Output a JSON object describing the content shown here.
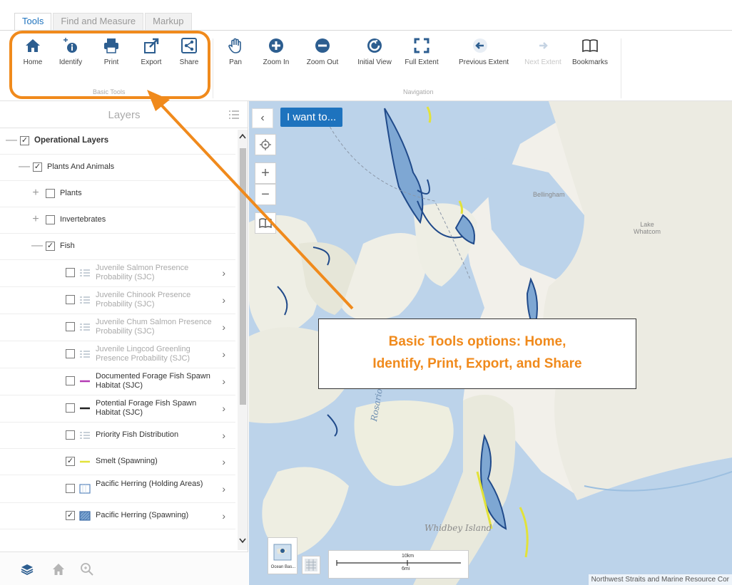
{
  "ribbon": {
    "tabs": [
      "Tools",
      "Find and Measure",
      "Markup"
    ],
    "basic_tools": {
      "group_label": "Basic Tools",
      "items": [
        {
          "label": "Home",
          "icon": "home-icon"
        },
        {
          "label": "Identify",
          "icon": "identify-icon"
        },
        {
          "label": "Print",
          "icon": "print-icon"
        },
        {
          "label": "Export",
          "icon": "export-icon"
        },
        {
          "label": "Share",
          "icon": "share-icon"
        }
      ]
    },
    "navigation": {
      "group_label": "Navigation",
      "items": [
        {
          "label": "Pan",
          "icon": "pan-hand-icon"
        },
        {
          "label": "Zoom In",
          "icon": "zoom-in-icon"
        },
        {
          "label": "Zoom Out",
          "icon": "zoom-out-icon"
        },
        {
          "label": "Initial View",
          "icon": "initial-view-icon"
        },
        {
          "label": "Full Extent",
          "icon": "full-extent-icon"
        },
        {
          "label": "Previous Extent",
          "icon": "previous-extent-icon"
        },
        {
          "label": "Next Extent",
          "icon": "next-extent-icon"
        },
        {
          "label": "Bookmarks",
          "icon": "bookmarks-icon"
        }
      ]
    }
  },
  "layers_panel": {
    "title": "Layers",
    "rows": [
      {
        "label": "Operational Layers",
        "checked": true,
        "expander": "—"
      },
      {
        "label": "Plants And Animals",
        "checked": true,
        "expander": "—"
      },
      {
        "label": "Plants",
        "checked": false,
        "expander": "+"
      },
      {
        "label": "Invertebrates",
        "checked": false,
        "expander": "+"
      },
      {
        "label": "Fish",
        "checked": true,
        "expander": "—"
      },
      {
        "label": "Juvenile Salmon Presence Probability (SJC)",
        "checked": false
      },
      {
        "label": "Juvenile Chinook Presence Probability (SJC)",
        "checked": false
      },
      {
        "label": "Juvenile Chum Salmon Presence Probability (SJC)",
        "checked": false
      },
      {
        "label": "Juvenile Lingcod Greenling Presence Probability (SJC)",
        "checked": false
      },
      {
        "label": "Documented Forage Fish Spawn Habitat (SJC)",
        "checked": false
      },
      {
        "label": "Potential Forage Fish Spawn Habitat (SJC)",
        "checked": false
      },
      {
        "label": "Priority Fish Distribution",
        "checked": false
      },
      {
        "label": "Smelt (Spawning)",
        "checked": true
      },
      {
        "label": "Pacific Herring (Holding Areas)",
        "checked": false
      },
      {
        "label": "Pacific Herring (Spawning)",
        "checked": true
      }
    ],
    "check_mark": "✓",
    "chevron": "›"
  },
  "map": {
    "i_want_to": "I want to...",
    "collapse": "‹",
    "zoom_in": "+",
    "zoom_out": "−",
    "basemap_label": "Ocean Bas...",
    "scale_km": "10km",
    "scale_mi": "6mi",
    "attribution": "Northwest Straits and Marine Resource Cor",
    "places": {
      "bellingham": "Bellingham",
      "lake_whatcom": "Lake Whatcom",
      "rosario_strait": "Rosario Strait",
      "whidbey_island": "Whidbey Island"
    }
  },
  "callout": {
    "line1": "Basic Tools options: Home,",
    "line2": "Identify, Print, Export, and Share"
  },
  "colors": {
    "accent_orange": "#f08a1c",
    "brand_blue": "#1e73be",
    "water": "#bcd3ea",
    "land": "#f2f0ea",
    "smelt_yellow": "#e2e23a"
  }
}
